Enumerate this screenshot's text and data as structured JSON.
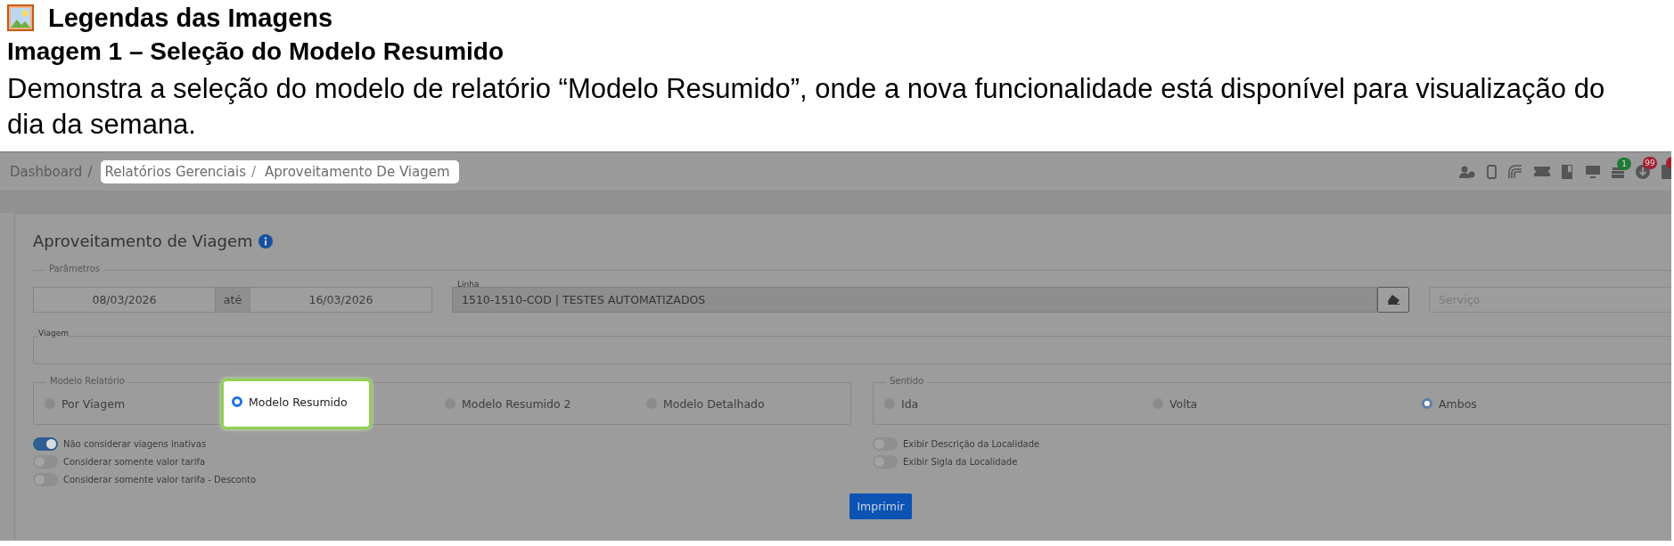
{
  "document": {
    "title": "Legendas das Imagens",
    "heading": "Imagem 1 – Seleção do Modelo Resumido",
    "paragraph": "Demonstra a seleção do modelo de relatório “Modelo Resumido”, onde a nova funcionalidade está disponível para visualização do dia da semana."
  },
  "screen": {
    "breadcrumb": {
      "separator": "/",
      "items": [
        {
          "label": "Dashboard",
          "highlighted": false
        },
        {
          "label": "Relatórios Gerenciais",
          "highlighted": true
        },
        {
          "label": "Aproveitamento De Viagem",
          "highlighted": true
        }
      ]
    },
    "toolbar_icons": [
      {
        "kind": "user"
      },
      {
        "kind": "phone"
      },
      {
        "kind": "signal"
      },
      {
        "kind": "ticket"
      },
      {
        "kind": "book"
      },
      {
        "kind": "monitor"
      },
      {
        "kind": "stack",
        "badge": "1",
        "color": "#1f7a35"
      },
      {
        "kind": "download",
        "badge": "99",
        "color": "#a3202e"
      },
      {
        "kind": "file",
        "color": "#a3202e"
      }
    ],
    "page_title": "Aproveitamento de Viagem",
    "parameters": {
      "legend": "Parâmetros",
      "date_from": "08/03/2026",
      "date_separator": "até",
      "date_to": "16/03/2026",
      "linha": {
        "label": "Linha",
        "value": "1510-1510-COD | TESTES AUTOMATIZADOS"
      },
      "servico": {
        "placeholder": "Serviço"
      }
    },
    "viagem": {
      "label": "Viagem"
    },
    "modelo_relatorio": {
      "legend": "Modelo Relatório",
      "options": [
        {
          "label": "Por Viagem",
          "selected": false,
          "highlighted": false
        },
        {
          "label": "Modelo Resumido",
          "selected": true,
          "highlighted": true
        },
        {
          "label": "Modelo Resumido 2",
          "selected": false,
          "highlighted": false
        },
        {
          "label": "Modelo Detalhado",
          "selected": false,
          "highlighted": false
        }
      ]
    },
    "sentido": {
      "legend": "Sentido",
      "options": [
        {
          "label": "Ida",
          "selected": false
        },
        {
          "label": "Volta",
          "selected": false
        },
        {
          "label": "Ambos",
          "selected": true
        }
      ]
    },
    "toggles_left": [
      {
        "label": "Não considerar viagens inativas",
        "on": true
      },
      {
        "label": "Considerar somente valor tarifa",
        "on": false
      },
      {
        "label": "Considerar somente valor tarifa - Desconto",
        "on": false
      }
    ],
    "toggles_right": [
      {
        "label": "Exibir Descrição da Localidade",
        "on": false
      },
      {
        "label": "Exibir Sigla da Localidade",
        "on": false
      }
    ],
    "print_button": "Imprimir"
  }
}
